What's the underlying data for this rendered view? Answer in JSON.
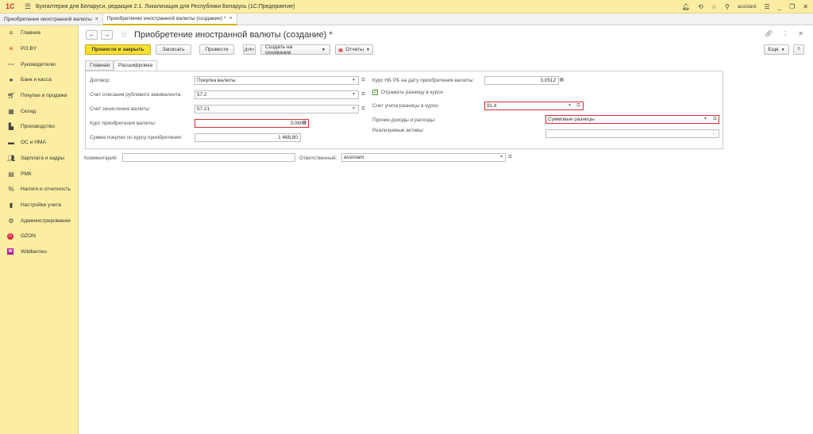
{
  "app": {
    "title": "Бухгалтерия для Беларуси, редакция 2.1. Локализация для Республики Беларусь   (1С:Предприятие)",
    "logo": "1С",
    "user": "assistant"
  },
  "tabs": [
    {
      "label": "Приобретение иностранной валюты"
    },
    {
      "label": "Приобретение иностранной валюты (создание) *"
    }
  ],
  "sidebar": {
    "items": [
      {
        "label": "Главное",
        "icon": "menu-icon"
      },
      {
        "label": "PO.BY",
        "icon": "sun-icon"
      },
      {
        "label": "Руководителю",
        "icon": "trend-icon"
      },
      {
        "label": "Банк и касса",
        "icon": "bank-icon"
      },
      {
        "label": "Покупки и продажи",
        "icon": "cart-icon"
      },
      {
        "label": "Склад",
        "icon": "warehouse-icon"
      },
      {
        "label": "Производство",
        "icon": "factory-icon"
      },
      {
        "label": "ОС и НМА",
        "icon": "truck-icon"
      },
      {
        "label": "Зарплата и кадры",
        "icon": "people-icon"
      },
      {
        "label": "РМК",
        "icon": "register-icon"
      },
      {
        "label": "Налоги и отчетность",
        "icon": "tax-icon"
      },
      {
        "label": "Настройки учета",
        "icon": "book-icon"
      },
      {
        "label": "Администрирование",
        "icon": "gear-icon"
      },
      {
        "label": "OZON",
        "icon": "ozon-icon"
      },
      {
        "label": "Wildberries",
        "icon": "wb-icon"
      }
    ]
  },
  "document": {
    "title": "Приобретение иностранной валюты (создание) *"
  },
  "toolbar": {
    "post_close": "Провести и закрыть",
    "save": "Записать",
    "post": "Провести",
    "create_based": "Создать на основании",
    "reports": "Отчеты",
    "more": "Еще",
    "help": "?"
  },
  "form_tabs": {
    "main": "Главная",
    "breakdown": "Расшифровка"
  },
  "left": {
    "contract": {
      "label": "Договор:",
      "value": "Покупка валюты"
    },
    "debit_account": {
      "label": "Счет списания рублевого эквивалента:",
      "value": "57.2"
    },
    "credit_account": {
      "label": "Счет зачисления валюты:",
      "value": "57.21"
    },
    "purchase_rate": {
      "label": "Курс приобретения валюты:",
      "value": "3,0600"
    },
    "purchase_amount": {
      "label": "Сумма покупки  по курсу приобретения:",
      "value": "1 468,80"
    }
  },
  "right": {
    "nb_rate": {
      "label": "Курс НБ РБ на дату приобретения валюты:",
      "value": "3,0512"
    },
    "reflect_diff": {
      "label": "Отражать разницу в курсе",
      "checked": true
    },
    "diff_account": {
      "label": "Счет учета разницы в курсе:",
      "value": "91.4"
    },
    "other_income": {
      "label": "Прочие доходы и расходы:",
      "value": "Суммовые разницы"
    },
    "assets": {
      "label": "Реализуемые активы:",
      "value": ""
    }
  },
  "footer": {
    "comment_label": "Комментарий:",
    "comment_value": "",
    "responsible_label": "Ответственный:",
    "responsible_value": "assistant"
  },
  "colors": {
    "accent": "#fbeda1",
    "primary_button": "#f7e034",
    "error_border": "#d42f2f"
  }
}
